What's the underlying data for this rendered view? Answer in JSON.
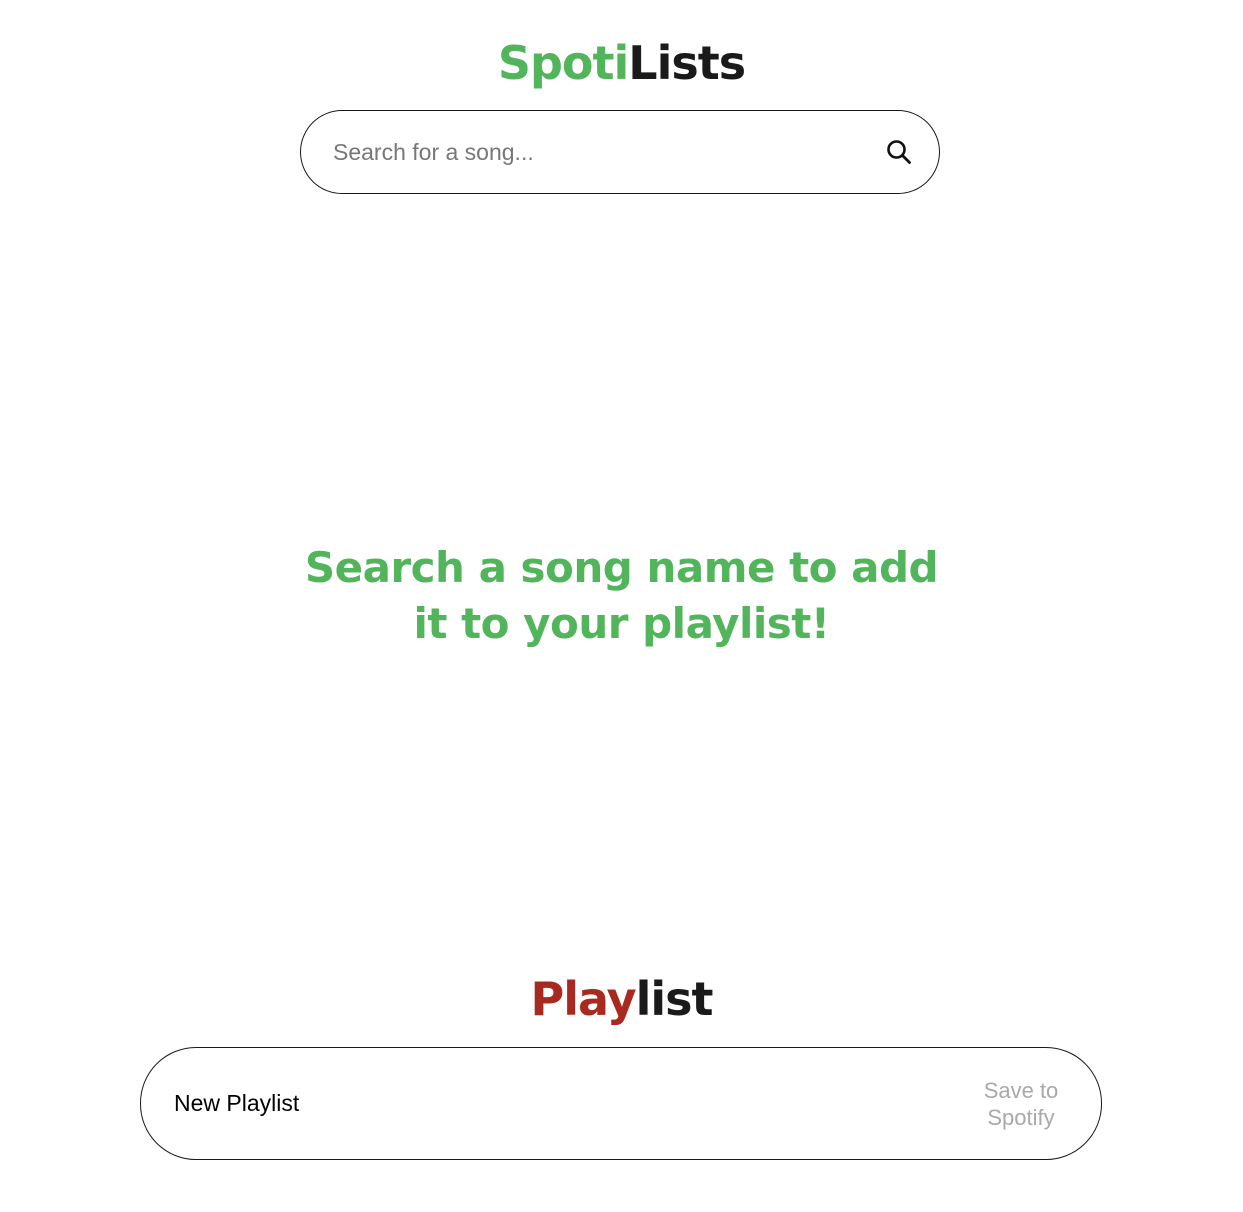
{
  "app": {
    "logo_part1": "Spoti",
    "logo_part2": "Lists"
  },
  "search": {
    "placeholder": "Search for a song...",
    "icon": "search-icon"
  },
  "main": {
    "empty_prompt_line1": "Search a song name to add",
    "empty_prompt_line2": "it to your playlist!"
  },
  "playlist": {
    "heading_part1": "Play",
    "heading_part2": "list",
    "name_value": "New Playlist",
    "save_label_line1": "Save to",
    "save_label_line2": "Spotify"
  },
  "colors": {
    "brand_green": "#52b55c",
    "accent_red": "#a8291f",
    "text_dark": "#1a1a1a",
    "disabled_gray": "#a9a9a9"
  }
}
